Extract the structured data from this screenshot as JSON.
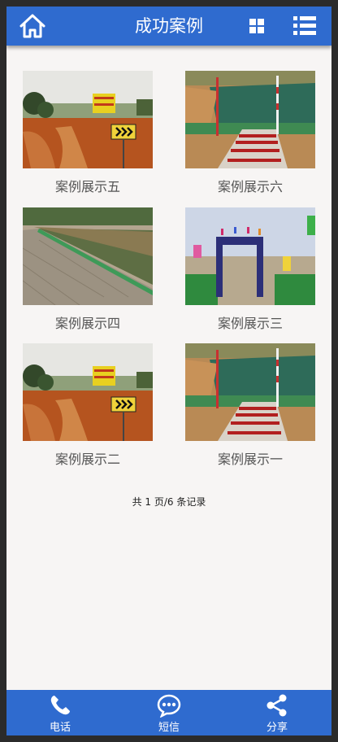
{
  "header": {
    "title": "成功案例",
    "home_icon": "home-icon",
    "grid_icon": "grid-view-icon",
    "menu_icon": "list-menu-icon",
    "color": "#2f6bcf"
  },
  "cases": [
    {
      "caption": "案例展示五",
      "image": "road-sign-photo"
    },
    {
      "caption": "案例展示六",
      "image": "pond-bridge-photo"
    },
    {
      "caption": "案例展示四",
      "image": "riverbank-photo"
    },
    {
      "caption": "案例展示三",
      "image": "gate-flags-photo"
    },
    {
      "caption": "案例展示二",
      "image": "road-sign-photo"
    },
    {
      "caption": "案例展示一",
      "image": "pond-bridge-photo"
    }
  ],
  "pagination": {
    "text": "共 1 页/6 条记录"
  },
  "footer": {
    "items": [
      {
        "label": "电话",
        "icon": "phone-icon"
      },
      {
        "label": "短信",
        "icon": "sms-icon"
      },
      {
        "label": "分享",
        "icon": "share-icon"
      }
    ]
  }
}
